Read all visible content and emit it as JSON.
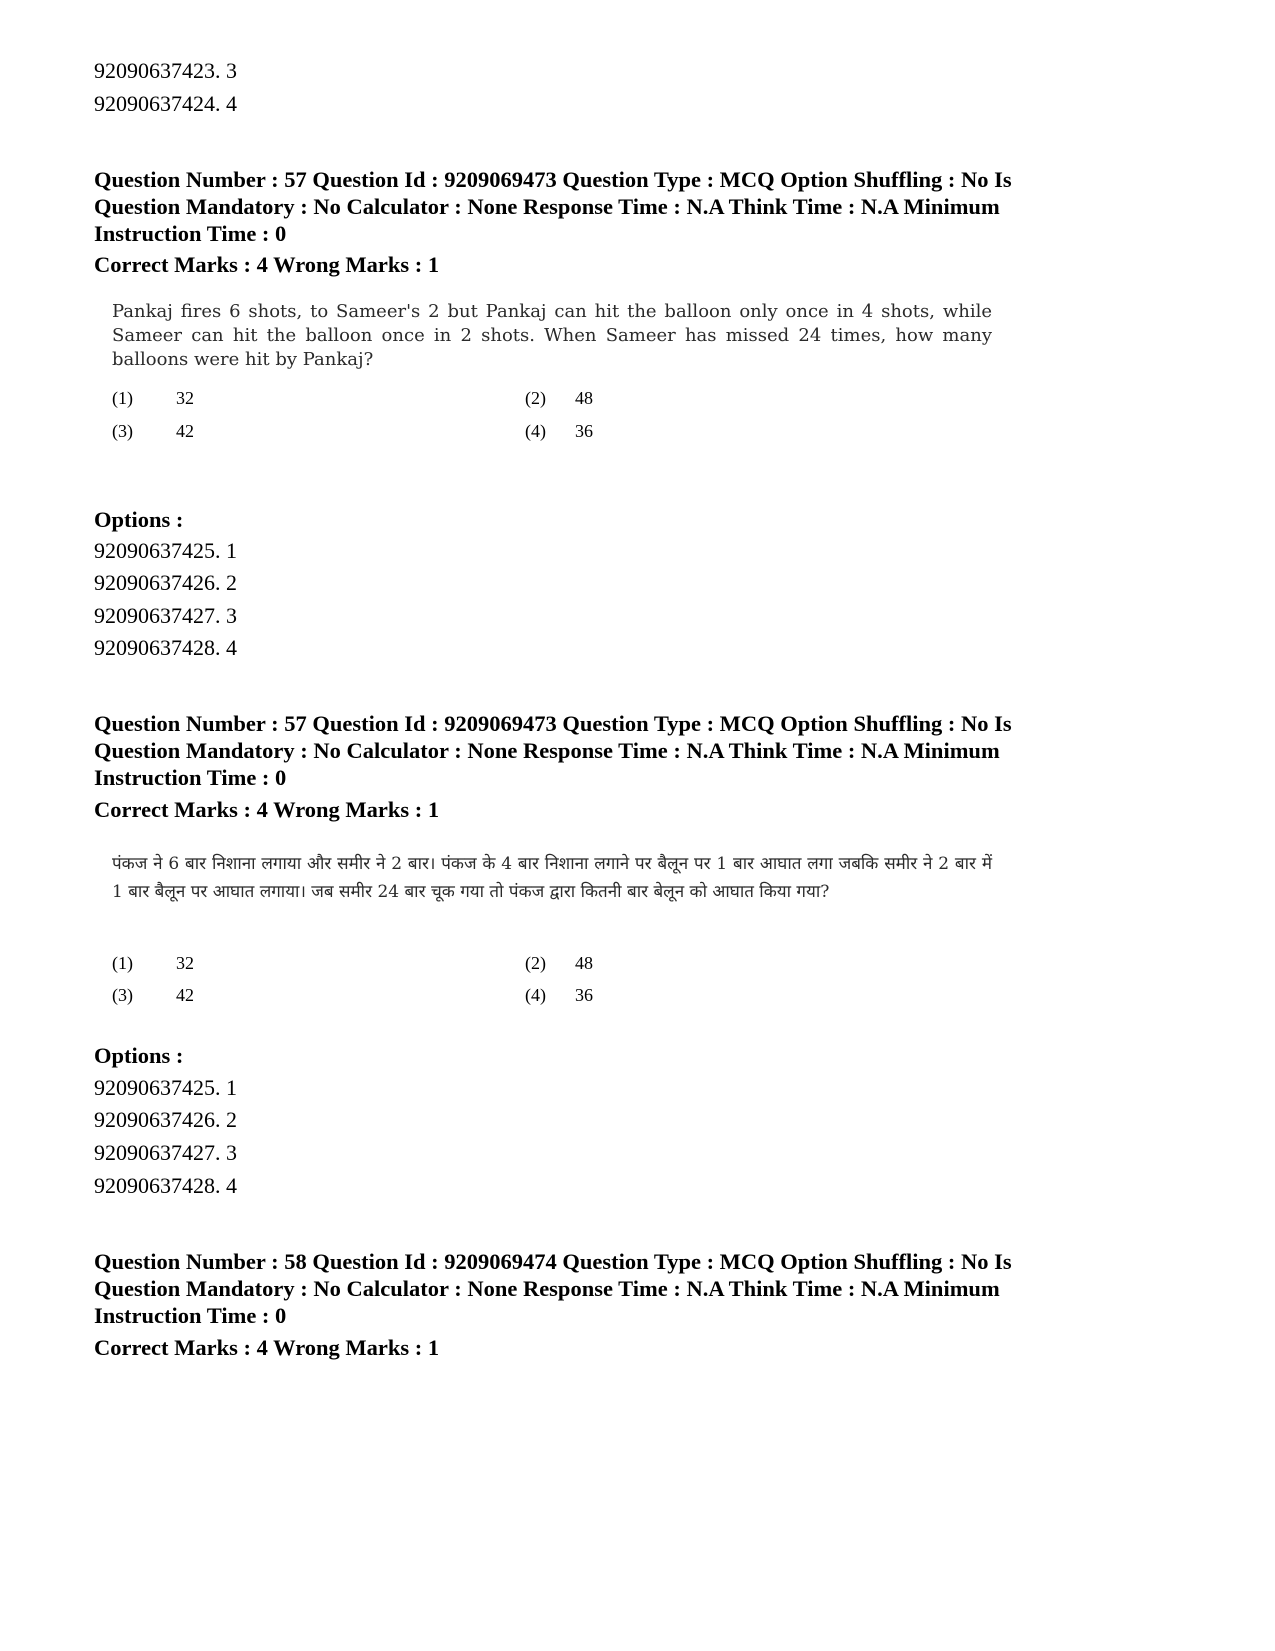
{
  "top_options": [
    {
      "id": "92090637423",
      "value": "3"
    },
    {
      "id": "92090637424",
      "value": "4"
    }
  ],
  "blocks": [
    {
      "meta": "Question Number : 57 Question Id : 9209069473 Question Type : MCQ Option Shuffling : No Is Question Mandatory : No Calculator : None Response Time : N.A Think Time : N.A Minimum Instruction Time : 0",
      "marks": "Correct Marks : 4 Wrong Marks : 1",
      "question_text": "Pankaj fires 6 shots, to Sameer's 2 but Pankaj can hit the balloon only once in 4 shots, while Sameer can hit the balloon once in 2 shots. When Sameer has missed 24 times, how many balloons were hit by Pankaj?",
      "choices": [
        {
          "num": "(1)",
          "value": "32"
        },
        {
          "num": "(2)",
          "value": "48"
        },
        {
          "num": "(3)",
          "value": "42"
        },
        {
          "num": "(4)",
          "value": "36"
        }
      ],
      "options_label": "Options :",
      "options": [
        {
          "id": "92090637425",
          "value": "1"
        },
        {
          "id": "92090637426",
          "value": "2"
        },
        {
          "id": "92090637427",
          "value": "3"
        },
        {
          "id": "92090637428",
          "value": "4"
        }
      ]
    },
    {
      "meta": "Question Number : 57 Question Id : 9209069473 Question Type : MCQ Option Shuffling : No Is Question Mandatory : No Calculator : None Response Time : N.A Think Time : N.A Minimum Instruction Time : 0",
      "marks": "Correct Marks : 4 Wrong Marks : 1",
      "question_text": "पंकज ने 6 बार निशाना लगाया और समीर ने 2 बार। पंकज के 4 बार निशाना लगाने पर बैलून पर 1 बार आघात लगा जबकि समीर ने 2 बार में 1 बार बैलून पर आघात लगाया। जब समीर 24 बार चूक गया तो पंकज द्वारा कितनी बार बेलून को आघात किया गया?",
      "choices": [
        {
          "num": "(1)",
          "value": "32"
        },
        {
          "num": "(2)",
          "value": "48"
        },
        {
          "num": "(3)",
          "value": "42"
        },
        {
          "num": "(4)",
          "value": "36"
        }
      ],
      "options_label": "Options :",
      "options": [
        {
          "id": "92090637425",
          "value": "1"
        },
        {
          "id": "92090637426",
          "value": "2"
        },
        {
          "id": "92090637427",
          "value": "3"
        },
        {
          "id": "92090637428",
          "value": "4"
        }
      ]
    },
    {
      "meta": "Question Number : 58 Question Id : 9209069474 Question Type : MCQ Option Shuffling : No Is Question Mandatory : No Calculator : None Response Time : N.A Think Time : N.A Minimum Instruction Time : 0",
      "marks": "Correct Marks : 4 Wrong Marks : 1"
    }
  ]
}
